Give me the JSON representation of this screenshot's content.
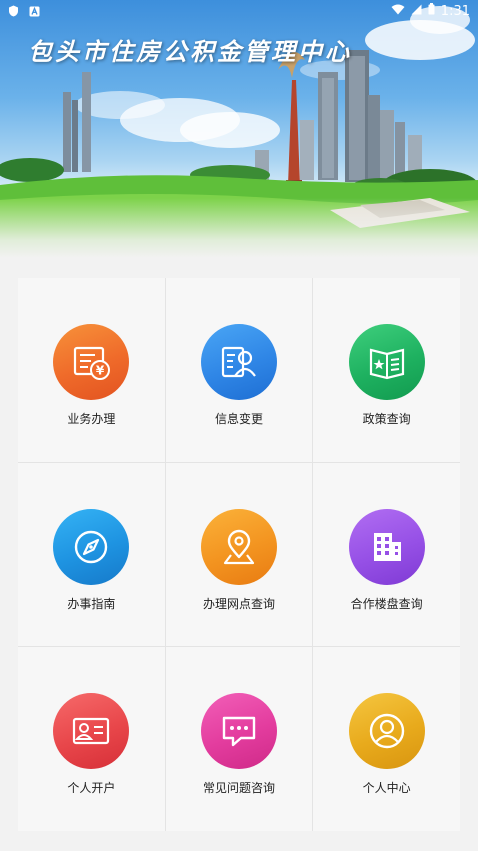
{
  "status_bar": {
    "time": "1:31",
    "icons": [
      "shield-icon",
      "a-icon",
      "wifi-icon",
      "signal-icon",
      "battery-icon"
    ]
  },
  "banner": {
    "title": "包头市住房公积金管理中心"
  },
  "menu": {
    "items": [
      {
        "label": "业务办理",
        "icon": "document-yen-icon",
        "color": "#ef6a2a"
      },
      {
        "label": "信息变更",
        "icon": "profile-card-icon",
        "color": "#2f86e6"
      },
      {
        "label": "政策查询",
        "icon": "policy-book-icon",
        "color": "#1eb160"
      },
      {
        "label": "办事指南",
        "icon": "compass-icon",
        "color": "#1e93e1"
      },
      {
        "label": "办理网点查询",
        "icon": "location-pin-icon",
        "color": "#f39420"
      },
      {
        "label": "合作楼盘查询",
        "icon": "building-icon",
        "color": "#9650e6"
      },
      {
        "label": "个人开户",
        "icon": "id-card-icon",
        "color": "#e8464a"
      },
      {
        "label": "常见问题咨询",
        "icon": "chat-bubble-icon",
        "color": "#e33c9e"
      },
      {
        "label": "个人中心",
        "icon": "user-circle-icon",
        "color": "#e8aa1c"
      }
    ]
  }
}
